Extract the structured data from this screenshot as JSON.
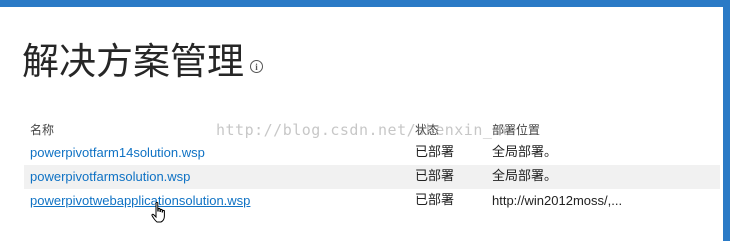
{
  "page": {
    "title": "解决方案管理",
    "info_icon": "info-icon"
  },
  "table": {
    "headers": {
      "name": "名称",
      "status": "状态",
      "location": "部署位置"
    },
    "rows": [
      {
        "name": "powerpivotfarm14solution.wsp",
        "status": "已部署",
        "location": "全局部署。"
      },
      {
        "name": "powerpivotfarmsolution.wsp",
        "status": "已部署",
        "location": "全局部署。"
      },
      {
        "name": "powerpivotwebapplicationsolution.wsp",
        "status": "已部署",
        "location": "http://win2012moss/,..."
      }
    ]
  },
  "watermark": "http://blog.csdn.net/shenxin_mu",
  "colors": {
    "accent": "#2a7ac6",
    "link": "#0f72c4",
    "alt_row": "#f1f1f1"
  },
  "cursor_icon": "hand-pointer-icon"
}
